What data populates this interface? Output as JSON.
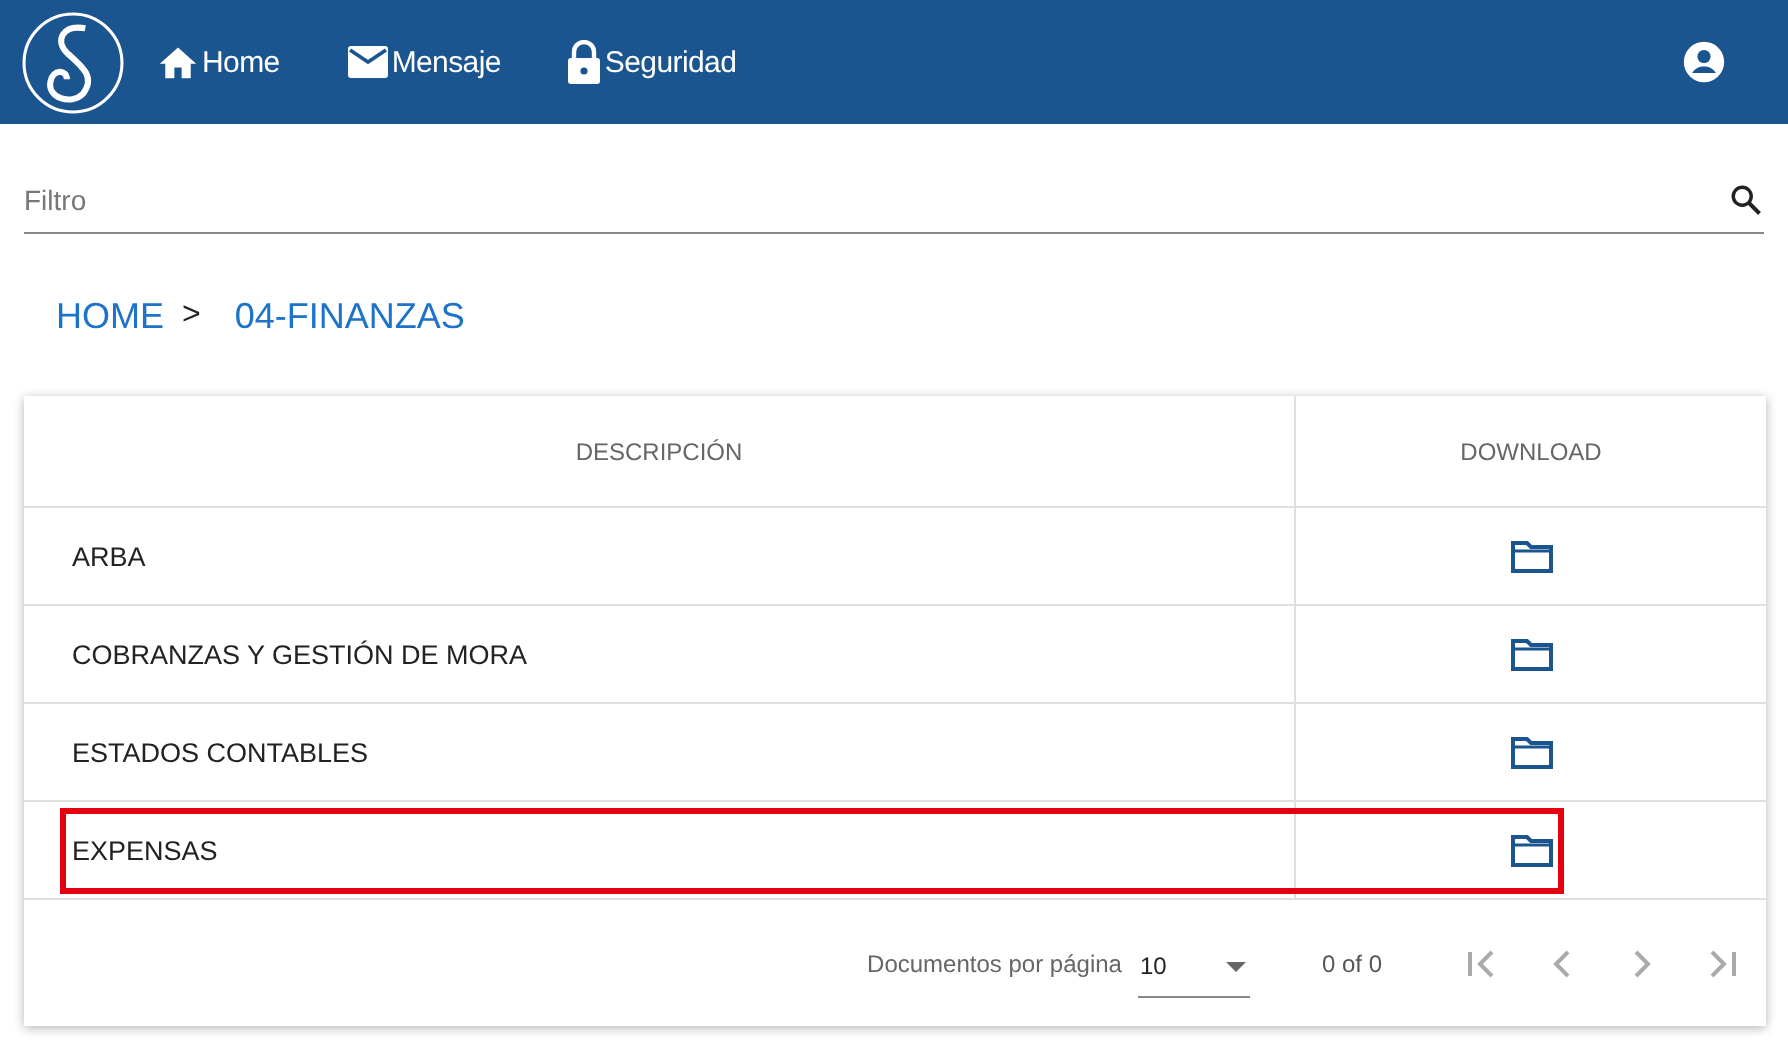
{
  "nav": {
    "items": [
      {
        "kind": "home",
        "label": "Home"
      },
      {
        "kind": "mail",
        "label": "Mensaje"
      },
      {
        "kind": "lock",
        "label": "Seguridad"
      }
    ]
  },
  "filter": {
    "placeholder": "Filtro"
  },
  "breadcrumb": [
    {
      "label": "HOME"
    },
    {
      "label": ">"
    },
    {
      "label": "04-FINANZAS"
    }
  ],
  "table": {
    "columns": [
      "DESCRIPCIÓN",
      "DOWNLOAD"
    ],
    "rows": [
      {
        "description": "ARBA",
        "highlighted": false
      },
      {
        "description": "COBRANZAS Y GESTIÓN DE MORA",
        "highlighted": false
      },
      {
        "description": "ESTADOS CONTABLES",
        "highlighted": false
      },
      {
        "description": "EXPENSAS",
        "highlighted": true
      }
    ]
  },
  "paginator": {
    "label": "Documentos por página",
    "page_size": "10",
    "range": "0 of 0",
    "buttons": [
      {
        "kind": "first",
        "disabled": true
      },
      {
        "kind": "prev",
        "disabled": true
      },
      {
        "kind": "next",
        "disabled": true
      },
      {
        "kind": "last",
        "disabled": true
      }
    ]
  }
}
